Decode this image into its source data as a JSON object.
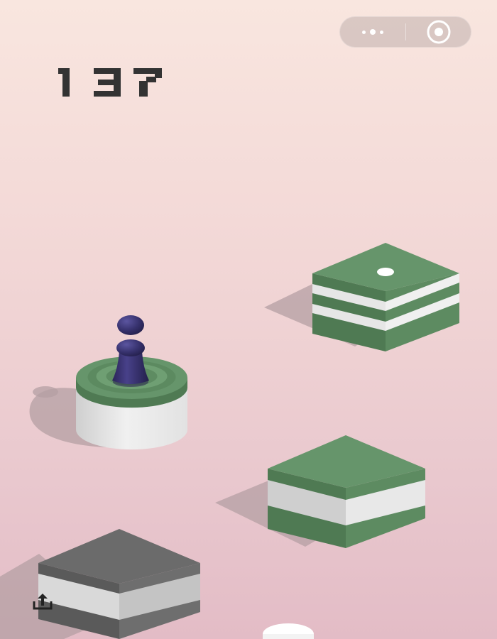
{
  "game": {
    "score": "137"
  },
  "capsule": {
    "more_icon": "more-dots-icon",
    "close_icon": "target-circle-icon"
  },
  "share": {
    "icon": "share-upload-icon"
  },
  "colors": {
    "background_top": "#f9e6df",
    "background_bottom": "#e3bcc6",
    "score": "#333333",
    "green_top": "#66956b",
    "green_left": "#4f7a53",
    "white_side": "#e3e3e3",
    "gray_top": "#6b6b6b",
    "player": "#3b2f6b"
  }
}
